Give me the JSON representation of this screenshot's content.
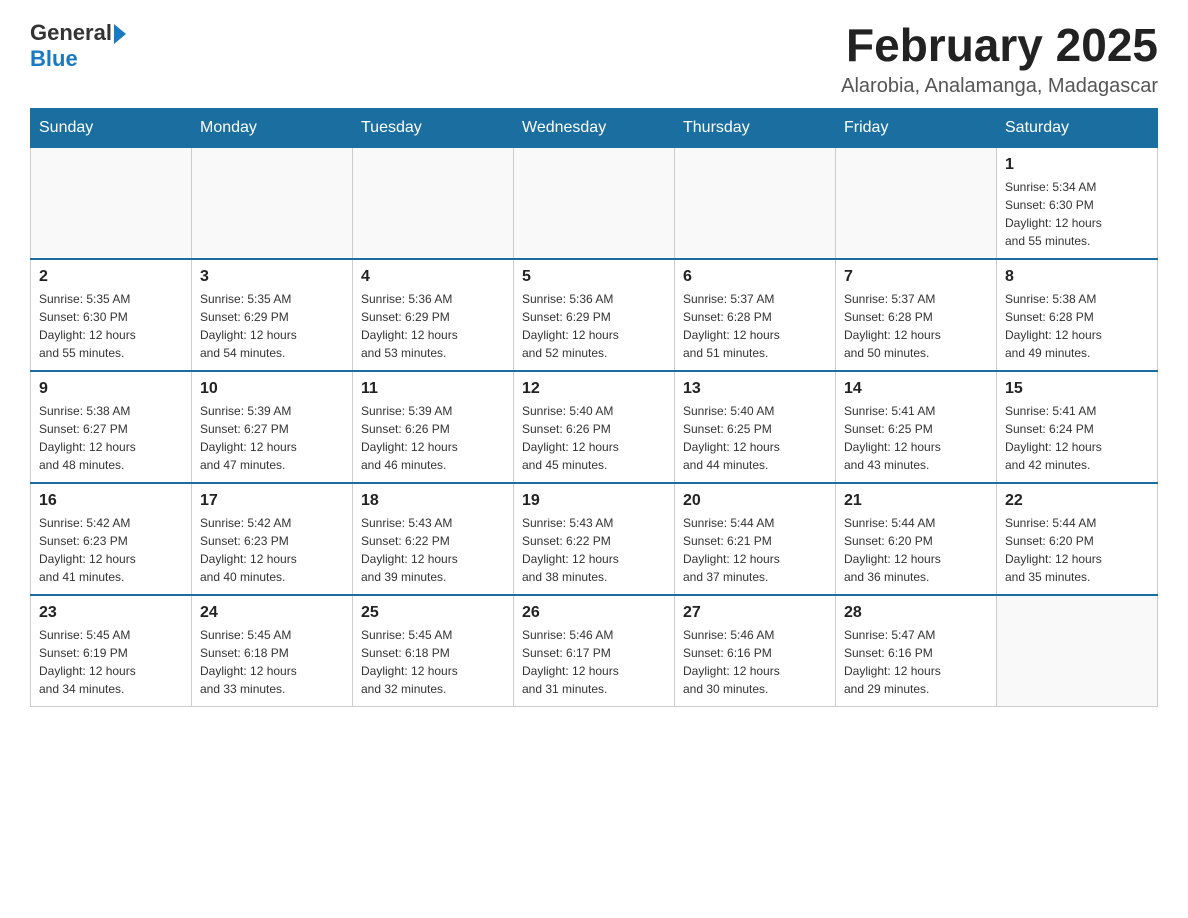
{
  "header": {
    "logo_text_general": "General",
    "logo_text_blue": "Blue",
    "month_title": "February 2025",
    "location": "Alarobia, Analamanga, Madagascar"
  },
  "days_of_week": [
    "Sunday",
    "Monday",
    "Tuesday",
    "Wednesday",
    "Thursday",
    "Friday",
    "Saturday"
  ],
  "weeks": [
    [
      {
        "day": "",
        "info": ""
      },
      {
        "day": "",
        "info": ""
      },
      {
        "day": "",
        "info": ""
      },
      {
        "day": "",
        "info": ""
      },
      {
        "day": "",
        "info": ""
      },
      {
        "day": "",
        "info": ""
      },
      {
        "day": "1",
        "info": "Sunrise: 5:34 AM\nSunset: 6:30 PM\nDaylight: 12 hours\nand 55 minutes."
      }
    ],
    [
      {
        "day": "2",
        "info": "Sunrise: 5:35 AM\nSunset: 6:30 PM\nDaylight: 12 hours\nand 55 minutes."
      },
      {
        "day": "3",
        "info": "Sunrise: 5:35 AM\nSunset: 6:29 PM\nDaylight: 12 hours\nand 54 minutes."
      },
      {
        "day": "4",
        "info": "Sunrise: 5:36 AM\nSunset: 6:29 PM\nDaylight: 12 hours\nand 53 minutes."
      },
      {
        "day": "5",
        "info": "Sunrise: 5:36 AM\nSunset: 6:29 PM\nDaylight: 12 hours\nand 52 minutes."
      },
      {
        "day": "6",
        "info": "Sunrise: 5:37 AM\nSunset: 6:28 PM\nDaylight: 12 hours\nand 51 minutes."
      },
      {
        "day": "7",
        "info": "Sunrise: 5:37 AM\nSunset: 6:28 PM\nDaylight: 12 hours\nand 50 minutes."
      },
      {
        "day": "8",
        "info": "Sunrise: 5:38 AM\nSunset: 6:28 PM\nDaylight: 12 hours\nand 49 minutes."
      }
    ],
    [
      {
        "day": "9",
        "info": "Sunrise: 5:38 AM\nSunset: 6:27 PM\nDaylight: 12 hours\nand 48 minutes."
      },
      {
        "day": "10",
        "info": "Sunrise: 5:39 AM\nSunset: 6:27 PM\nDaylight: 12 hours\nand 47 minutes."
      },
      {
        "day": "11",
        "info": "Sunrise: 5:39 AM\nSunset: 6:26 PM\nDaylight: 12 hours\nand 46 minutes."
      },
      {
        "day": "12",
        "info": "Sunrise: 5:40 AM\nSunset: 6:26 PM\nDaylight: 12 hours\nand 45 minutes."
      },
      {
        "day": "13",
        "info": "Sunrise: 5:40 AM\nSunset: 6:25 PM\nDaylight: 12 hours\nand 44 minutes."
      },
      {
        "day": "14",
        "info": "Sunrise: 5:41 AM\nSunset: 6:25 PM\nDaylight: 12 hours\nand 43 minutes."
      },
      {
        "day": "15",
        "info": "Sunrise: 5:41 AM\nSunset: 6:24 PM\nDaylight: 12 hours\nand 42 minutes."
      }
    ],
    [
      {
        "day": "16",
        "info": "Sunrise: 5:42 AM\nSunset: 6:23 PM\nDaylight: 12 hours\nand 41 minutes."
      },
      {
        "day": "17",
        "info": "Sunrise: 5:42 AM\nSunset: 6:23 PM\nDaylight: 12 hours\nand 40 minutes."
      },
      {
        "day": "18",
        "info": "Sunrise: 5:43 AM\nSunset: 6:22 PM\nDaylight: 12 hours\nand 39 minutes."
      },
      {
        "day": "19",
        "info": "Sunrise: 5:43 AM\nSunset: 6:22 PM\nDaylight: 12 hours\nand 38 minutes."
      },
      {
        "day": "20",
        "info": "Sunrise: 5:44 AM\nSunset: 6:21 PM\nDaylight: 12 hours\nand 37 minutes."
      },
      {
        "day": "21",
        "info": "Sunrise: 5:44 AM\nSunset: 6:20 PM\nDaylight: 12 hours\nand 36 minutes."
      },
      {
        "day": "22",
        "info": "Sunrise: 5:44 AM\nSunset: 6:20 PM\nDaylight: 12 hours\nand 35 minutes."
      }
    ],
    [
      {
        "day": "23",
        "info": "Sunrise: 5:45 AM\nSunset: 6:19 PM\nDaylight: 12 hours\nand 34 minutes."
      },
      {
        "day": "24",
        "info": "Sunrise: 5:45 AM\nSunset: 6:18 PM\nDaylight: 12 hours\nand 33 minutes."
      },
      {
        "day": "25",
        "info": "Sunrise: 5:45 AM\nSunset: 6:18 PM\nDaylight: 12 hours\nand 32 minutes."
      },
      {
        "day": "26",
        "info": "Sunrise: 5:46 AM\nSunset: 6:17 PM\nDaylight: 12 hours\nand 31 minutes."
      },
      {
        "day": "27",
        "info": "Sunrise: 5:46 AM\nSunset: 6:16 PM\nDaylight: 12 hours\nand 30 minutes."
      },
      {
        "day": "28",
        "info": "Sunrise: 5:47 AM\nSunset: 6:16 PM\nDaylight: 12 hours\nand 29 minutes."
      },
      {
        "day": "",
        "info": ""
      }
    ]
  ]
}
